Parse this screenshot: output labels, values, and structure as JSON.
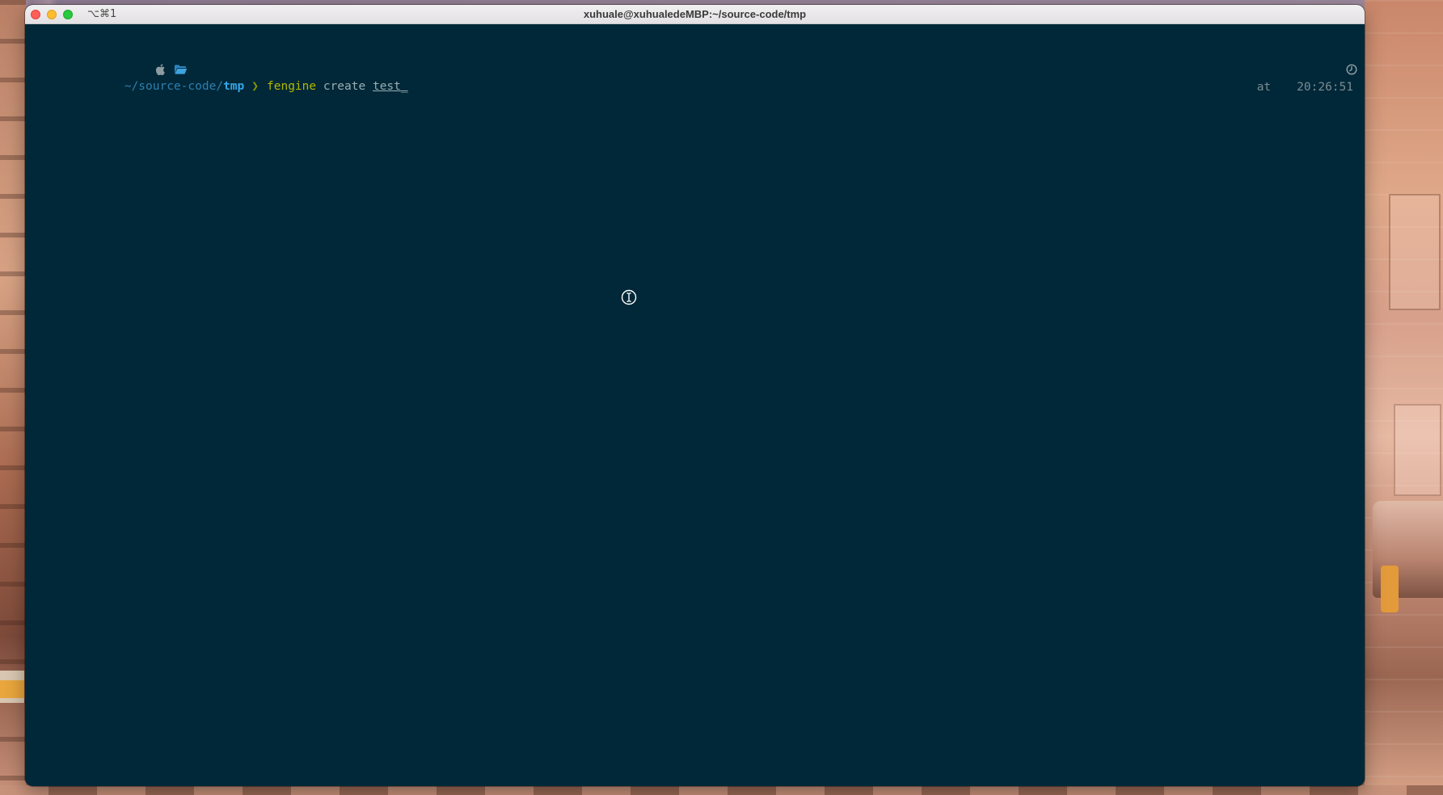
{
  "window": {
    "shortcut": "⌥⌘1",
    "title": "xuhuale@xuhualedeMBP:~/source-code/tmp"
  },
  "prompt": {
    "os_icon": "apple-icon",
    "dir_icon": "folder-icon",
    "path_prefix": "~/source-code/",
    "path_current": "tmp",
    "arrow": "❯",
    "command": "fengine",
    "arg1": "create",
    "arg2": "test",
    "cursor": "_"
  },
  "right_prompt": {
    "label": "at",
    "clock_icon": "clock-icon",
    "time": "20:26:51"
  },
  "colors": {
    "terminal_bg": "#002838",
    "path": "#2e7fb1",
    "path_current": "#35a6e8",
    "command": "#b5b800",
    "arrow": "#859900",
    "text": "#9aaeb4"
  }
}
